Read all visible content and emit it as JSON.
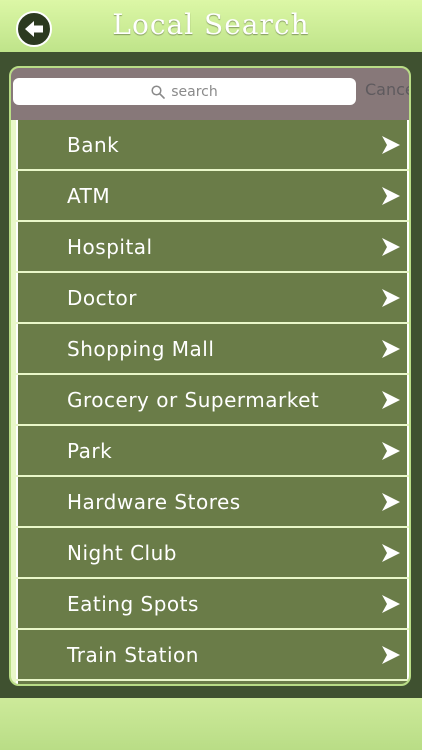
{
  "header": {
    "title": "Local Search",
    "back_icon": "back-arrow-icon"
  },
  "search": {
    "placeholder": "search",
    "cancel_label": "Cancel"
  },
  "list": {
    "items": [
      {
        "label": "Bank"
      },
      {
        "label": "ATM"
      },
      {
        "label": "Hospital"
      },
      {
        "label": "Doctor"
      },
      {
        "label": "Shopping Mall"
      },
      {
        "label": "Grocery or Supermarket"
      },
      {
        "label": "Park"
      },
      {
        "label": "Hardware Stores"
      },
      {
        "label": "Night Club"
      },
      {
        "label": "Eating Spots"
      },
      {
        "label": "Train Station"
      }
    ]
  },
  "colors": {
    "header_green": "#c9ec94",
    "row_green": "#6a7c48",
    "background_dark": "#3f5130",
    "search_bar_gray": "#877879"
  }
}
